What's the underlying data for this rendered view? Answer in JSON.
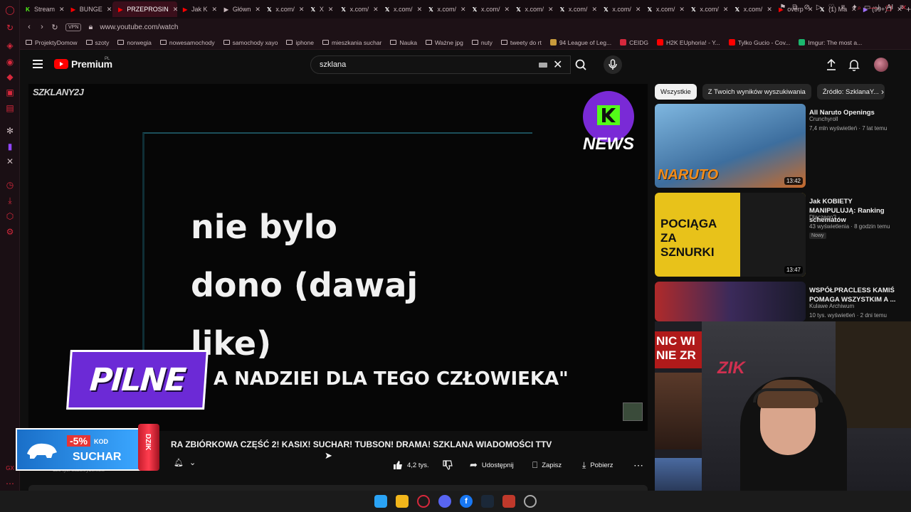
{
  "tabs": [
    {
      "label": "Stream",
      "icon": "kick-icon",
      "color": "#53fc18",
      "active": false
    },
    {
      "label": "BUNGE",
      "icon": "youtube-icon",
      "color": "#ff0000",
      "active": false
    },
    {
      "label": "PRZEPROSIN",
      "icon": "youtube-icon",
      "color": "#ff0000",
      "active": true
    },
    {
      "label": "Jak K",
      "icon": "youtube-icon",
      "color": "#ff0000",
      "active": false
    },
    {
      "label": "Główn",
      "icon": "globe-icon",
      "color": "#c9b9bd",
      "active": false
    },
    {
      "label": "x.com/",
      "icon": "x-icon",
      "color": "#ffffff",
      "active": false
    },
    {
      "label": "X",
      "icon": "x-icon",
      "color": "#ffffff",
      "active": false
    },
    {
      "label": "x.com/",
      "icon": "x-icon",
      "color": "#ffffff",
      "active": false
    },
    {
      "label": "x.com/",
      "icon": "x-icon",
      "color": "#ffffff",
      "active": false
    },
    {
      "label": "x.com/",
      "icon": "x-icon",
      "color": "#ffffff",
      "active": false
    },
    {
      "label": "x.com/",
      "icon": "x-icon",
      "color": "#ffffff",
      "active": false
    },
    {
      "label": "x.com/",
      "icon": "x-icon",
      "color": "#ffffff",
      "active": false
    },
    {
      "label": "x.com/",
      "icon": "x-icon",
      "color": "#ffffff",
      "active": false
    },
    {
      "label": "x.com/",
      "icon": "x-icon",
      "color": "#ffffff",
      "active": false
    },
    {
      "label": "x.com/",
      "icon": "x-icon",
      "color": "#ffffff",
      "active": false
    },
    {
      "label": "x.com/",
      "icon": "x-icon",
      "color": "#ffffff",
      "active": false
    },
    {
      "label": "x.com/",
      "icon": "x-icon",
      "color": "#ffffff",
      "active": false
    },
    {
      "label": "overp",
      "icon": "youtube-icon",
      "color": "#ff0000",
      "active": false
    },
    {
      "label": "(1) Ma",
      "icon": "x-icon",
      "color": "#ffffff",
      "active": false
    },
    {
      "label": "(99+) T",
      "icon": "messenger-icon",
      "color": "#a070ff",
      "active": false
    }
  ],
  "address": {
    "vpn_label": "VPN",
    "url": "www.youtube.com/watch",
    "ai_label": "AI"
  },
  "bookmarks": [
    {
      "label": "ProjektyDomow",
      "icon": "folder-icon"
    },
    {
      "label": "szoty",
      "icon": "folder-icon"
    },
    {
      "label": "norwegia",
      "icon": "folder-icon"
    },
    {
      "label": "nowesamochody",
      "icon": "folder-icon"
    },
    {
      "label": "samochody xayo",
      "icon": "folder-icon"
    },
    {
      "label": "iphone",
      "icon": "folder-icon"
    },
    {
      "label": "mieszkania suchar",
      "icon": "folder-icon"
    },
    {
      "label": "Nauka",
      "icon": "folder-icon"
    },
    {
      "label": "Ważne jpg",
      "icon": "folder-icon"
    },
    {
      "label": "nuty",
      "icon": "folder-icon"
    },
    {
      "label": "tweety do rt",
      "icon": "folder-icon"
    },
    {
      "label": "94 League of Leg...",
      "icon": "lol-icon"
    },
    {
      "label": "CEIDG",
      "icon": "ceidg-icon"
    },
    {
      "label": "H2K EUphoria! - Y...",
      "icon": "youtube-icon"
    },
    {
      "label": "Tylko Gucio - Cov...",
      "icon": "youtube-icon"
    },
    {
      "label": "Imgur: The most a...",
      "icon": "imgur-icon"
    }
  ],
  "youtube": {
    "brand": "Premium",
    "brand_region": "PL",
    "search_query": "szklana",
    "colors": {
      "brand_red": "#ff0000"
    }
  },
  "video": {
    "channel_tag": "SZKLANY2J",
    "news_logo_text": "NEWS",
    "caption_lines": [
      "nie bylo",
      "dono (dawaj",
      "like)"
    ],
    "badge_text": "PILNE",
    "ticker_text": "A NADZIEI DLA TEGO CZŁOWIEKA\"",
    "title": "RA ZBIÓRKOWA CZĘŚĆ 2! KASIX! SUCHAR! TUBSON! DRAMA! SZKLANA WIADOMOŚCI TTV",
    "subscriber_count": "120 tys. subskrybentów",
    "promo": {
      "discount": "-5%",
      "code_label": "KOD",
      "code": "SUCHAR",
      "can_text": "DZIK"
    },
    "likes": "4,2 tys.",
    "share_label": "Udostępnij",
    "save_label": "Zapisz",
    "download_label": "Pobierz"
  },
  "chips": [
    "Wszystkie",
    "Z Twoich wyników wyszukiwania",
    "Źródło: SzklanaY..."
  ],
  "recommendations": [
    {
      "title": "All Naruto Openings",
      "channel": "Crunchyroll",
      "meta": "7,4 mln wyświetleń · 7 lat temu",
      "duration": "13:42",
      "thumb_text": "NARUTO",
      "badge": ""
    },
    {
      "title": "Jak KOBIETY MANIPULUJĄ: Ranking schematów",
      "channel": "Dlaczego?",
      "meta": "43 wyświetlenia · 8 godzin temu",
      "duration": "13:47",
      "thumb_text": "POCIĄGA ZA SZNURKI",
      "badge": "Nowy"
    },
    {
      "title": "WSPÓŁPRACLESS KAMIŚ POMAGA WSZYSTKIM A ...",
      "channel": "Kulawe Archiwum",
      "meta": "10 tys. wyświetleń · 2 dni temu",
      "duration": "",
      "thumb_text": "NIC WI NIE ZR",
      "badge": ""
    }
  ],
  "webcam": {
    "overlay_text": "ZIK"
  }
}
